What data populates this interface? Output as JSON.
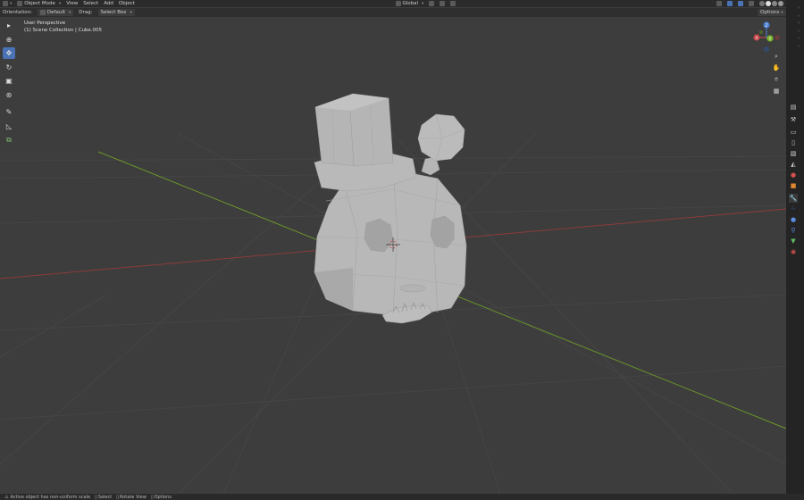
{
  "header": {
    "mode_label": "Object Mode",
    "menus": [
      "View",
      "Select",
      "Add",
      "Object"
    ],
    "orientation_value": "Global"
  },
  "tool_settings": {
    "orientation_label": "Orientation:",
    "orientation_value": "Default",
    "drag_label": "Drag:",
    "drag_value": "Select Box",
    "options_label": "Options"
  },
  "viewport": {
    "view_name": "User Perspective",
    "collection_info": "(1) Scene Collection | Cube.005",
    "gizmo_axes": {
      "x": "X",
      "y": "Y",
      "z": "Z"
    }
  },
  "left_tools": [
    "select-icon",
    "cursor-icon",
    "move-icon",
    "rotate-icon",
    "scale-icon",
    "transform-icon",
    "annotate-icon",
    "measure-icon",
    "add-cube-icon"
  ],
  "nav_buttons": [
    "zoom-icon",
    "pan-hand-icon",
    "camera-icon",
    "grid-icon"
  ],
  "status": {
    "warning": "Active object has non-uniform scale",
    "select": "Select",
    "rotate": "Rotate View",
    "options": "Options"
  },
  "colors": {
    "x_axis": "#9c3a3a",
    "y_axis": "#6f9a2c",
    "accent": "#4a73b5"
  }
}
